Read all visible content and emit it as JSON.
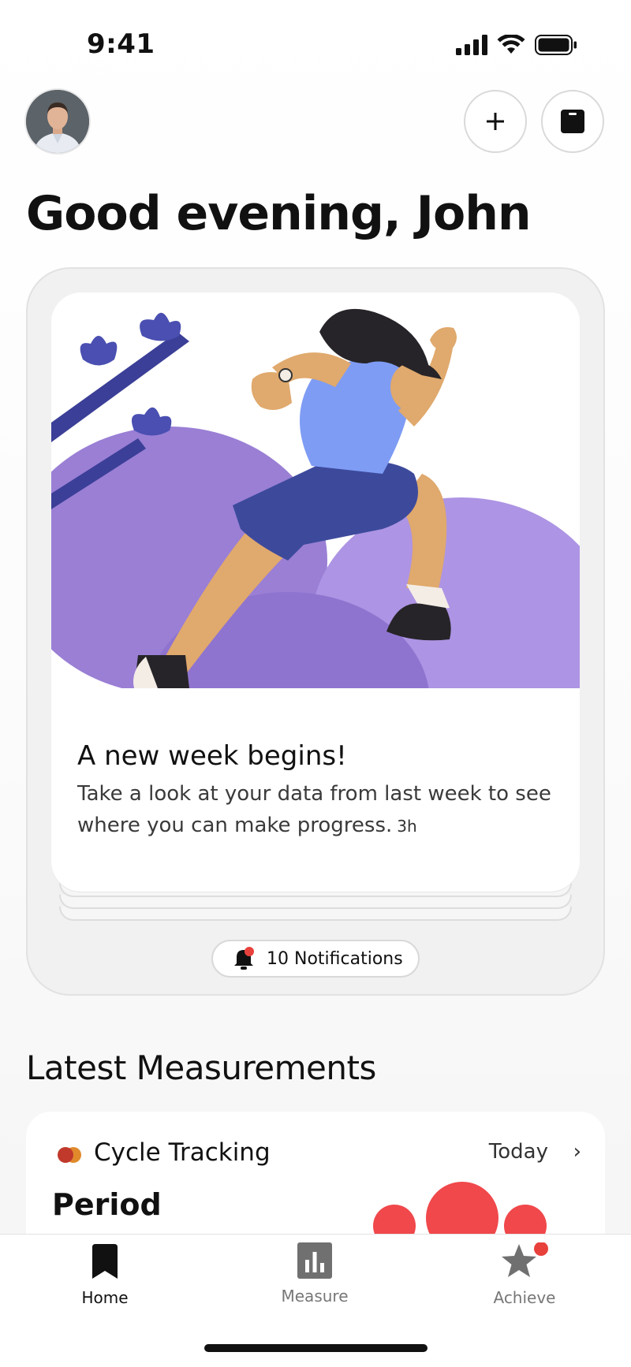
{
  "status_bar": {
    "time": "9:41",
    "icons": [
      "signal-icon",
      "wifi-icon",
      "battery-icon"
    ]
  },
  "header": {
    "greeting": "Good evening, John",
    "actions": [
      "add-icon",
      "scale-icon"
    ]
  },
  "feed": {
    "title": "A new week begins!",
    "body": "Take a look at your data from last week to see where you can make progress.",
    "time": "3h",
    "notifications_label": "10 Notifications"
  },
  "measurements": {
    "section_title": "Latest Measurements",
    "card": {
      "label": "Cycle Tracking",
      "date": "Today",
      "chevron": "›",
      "value": "Period"
    }
  },
  "tabs": [
    {
      "label": "Home",
      "icon": "bookmark-icon",
      "active": true
    },
    {
      "label": "Measure",
      "icon": "bar-chart-icon",
      "active": false
    },
    {
      "label": "Achieve",
      "icon": "star-icon",
      "active": false,
      "badge": true
    }
  ],
  "colors": {
    "accent_red": "#e8413c",
    "illustration_purple": "#9b7fd6",
    "illustration_navy": "#3d4a9c"
  }
}
